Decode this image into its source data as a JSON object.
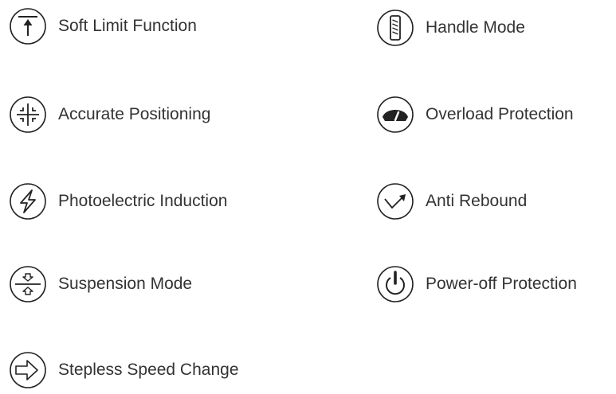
{
  "features": [
    {
      "icon": "soft-limit-icon",
      "label": "Soft Limit Function"
    },
    {
      "icon": "accurate-positioning-icon",
      "label": "Accurate Positioning"
    },
    {
      "icon": "photoelectric-induction-icon",
      "label": "Photoelectric Induction"
    },
    {
      "icon": "suspension-mode-icon",
      "label": "Suspension Mode"
    },
    {
      "icon": "stepless-speed-change-icon",
      "label": "Stepless Speed Change"
    },
    {
      "icon": "handle-mode-icon",
      "label": "Handle Mode"
    },
    {
      "icon": "overload-protection-icon",
      "label": "Overload Protection"
    },
    {
      "icon": "anti-rebound-icon",
      "label": "Anti Rebound"
    },
    {
      "icon": "power-off-protection-icon",
      "label": "Power-off Protection"
    }
  ],
  "colors": {
    "text": "#333333",
    "icon_stroke": "#222222",
    "background": "#ffffff"
  }
}
